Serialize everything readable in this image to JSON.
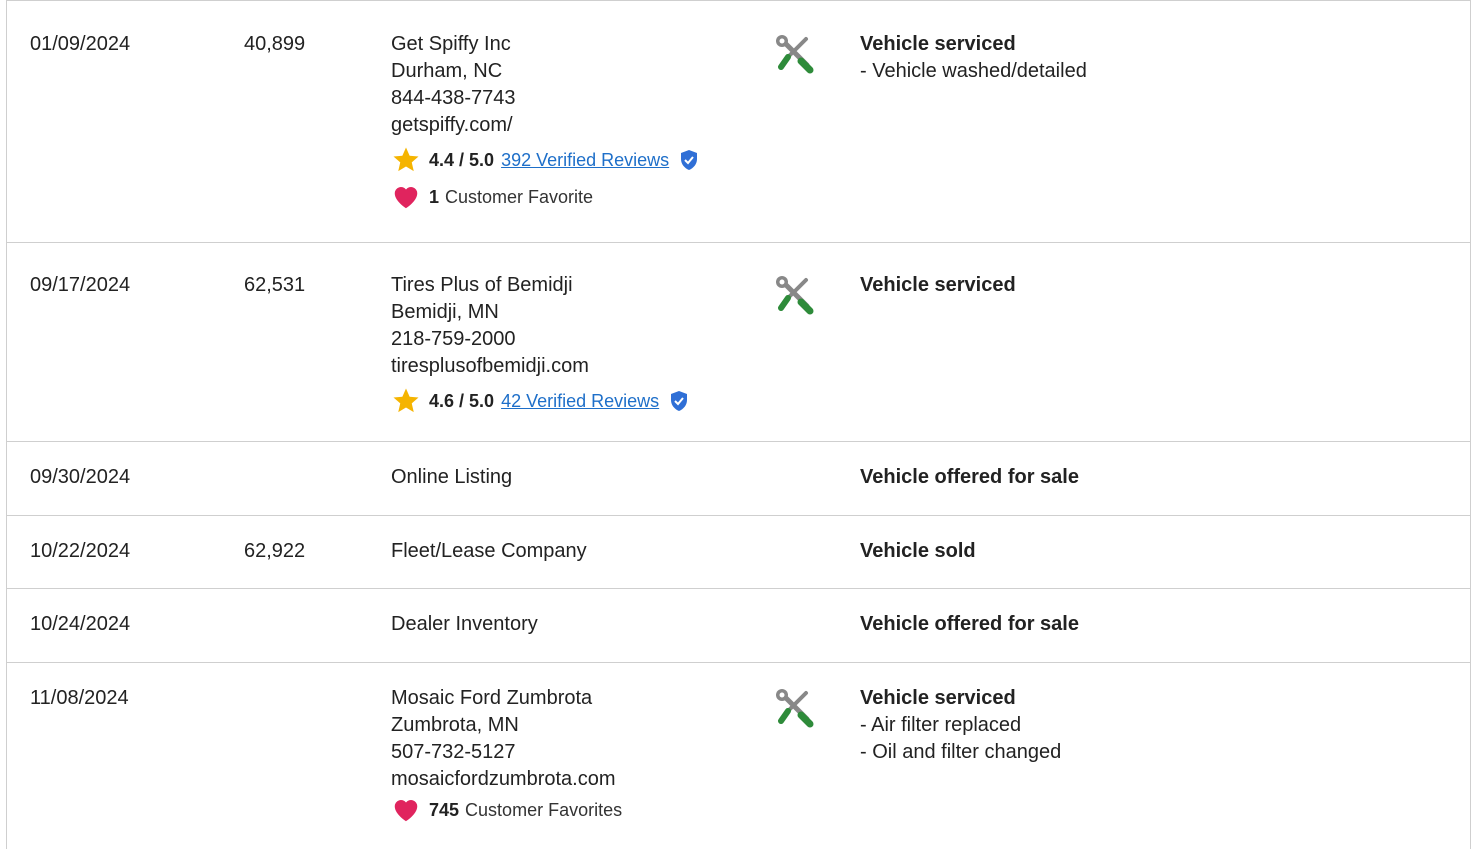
{
  "rows": [
    {
      "date": "01/09/2024",
      "odometer": "40,899",
      "source": [
        "Get Spiffy Inc",
        "Durham, NC",
        "844-438-7743",
        "getspiffy.com/"
      ],
      "rating": "4.4 / 5.0",
      "reviews": "392 Verified Reviews",
      "favorites_count": "1",
      "favorites_label": "Customer Favorite",
      "detail_title": "Vehicle serviced",
      "detail_items": [
        "- Vehicle washed/detailed"
      ]
    },
    {
      "date": "09/17/2024",
      "odometer": "62,531",
      "source": [
        "Tires Plus of Bemidji",
        "Bemidji, MN",
        "218-759-2000",
        "tiresplusofbemidji.com"
      ],
      "rating": "4.6 / 5.0",
      "reviews": "42 Verified Reviews",
      "detail_title": "Vehicle serviced",
      "detail_items": []
    },
    {
      "date": "09/30/2024",
      "odometer": "",
      "source": [
        "Online Listing"
      ],
      "detail_title": "Vehicle offered for sale"
    },
    {
      "date": "10/22/2024",
      "odometer": "62,922",
      "source": [
        "Fleet/Lease Company"
      ],
      "detail_title": "Vehicle sold"
    },
    {
      "date": "10/24/2024",
      "odometer": "",
      "source": [
        "Dealer Inventory"
      ],
      "detail_title": "Vehicle offered for sale"
    },
    {
      "date": "11/08/2024",
      "odometer": "",
      "source": [
        "Mosaic Ford Zumbrota",
        "Zumbrota, MN",
        "507-732-5127",
        "mosaicfordzumbrota.com"
      ],
      "favorites_count": "745",
      "favorites_label": "Customer Favorites",
      "detail_title": "Vehicle serviced",
      "detail_items": [
        "- Air filter replaced",
        "- Oil and filter changed"
      ]
    }
  ],
  "icons": {
    "service": "wrench-screwdriver-icon",
    "rating": "star-icon",
    "verified": "shield-check-icon",
    "favorite": "heart-icon"
  },
  "colors": {
    "star": "#f5b400",
    "heart": "#e0245e",
    "link": "#1e6fc9",
    "verified": "#2f6fd6",
    "screwdriver": "#2e8b3a",
    "wrench": "#888888"
  }
}
